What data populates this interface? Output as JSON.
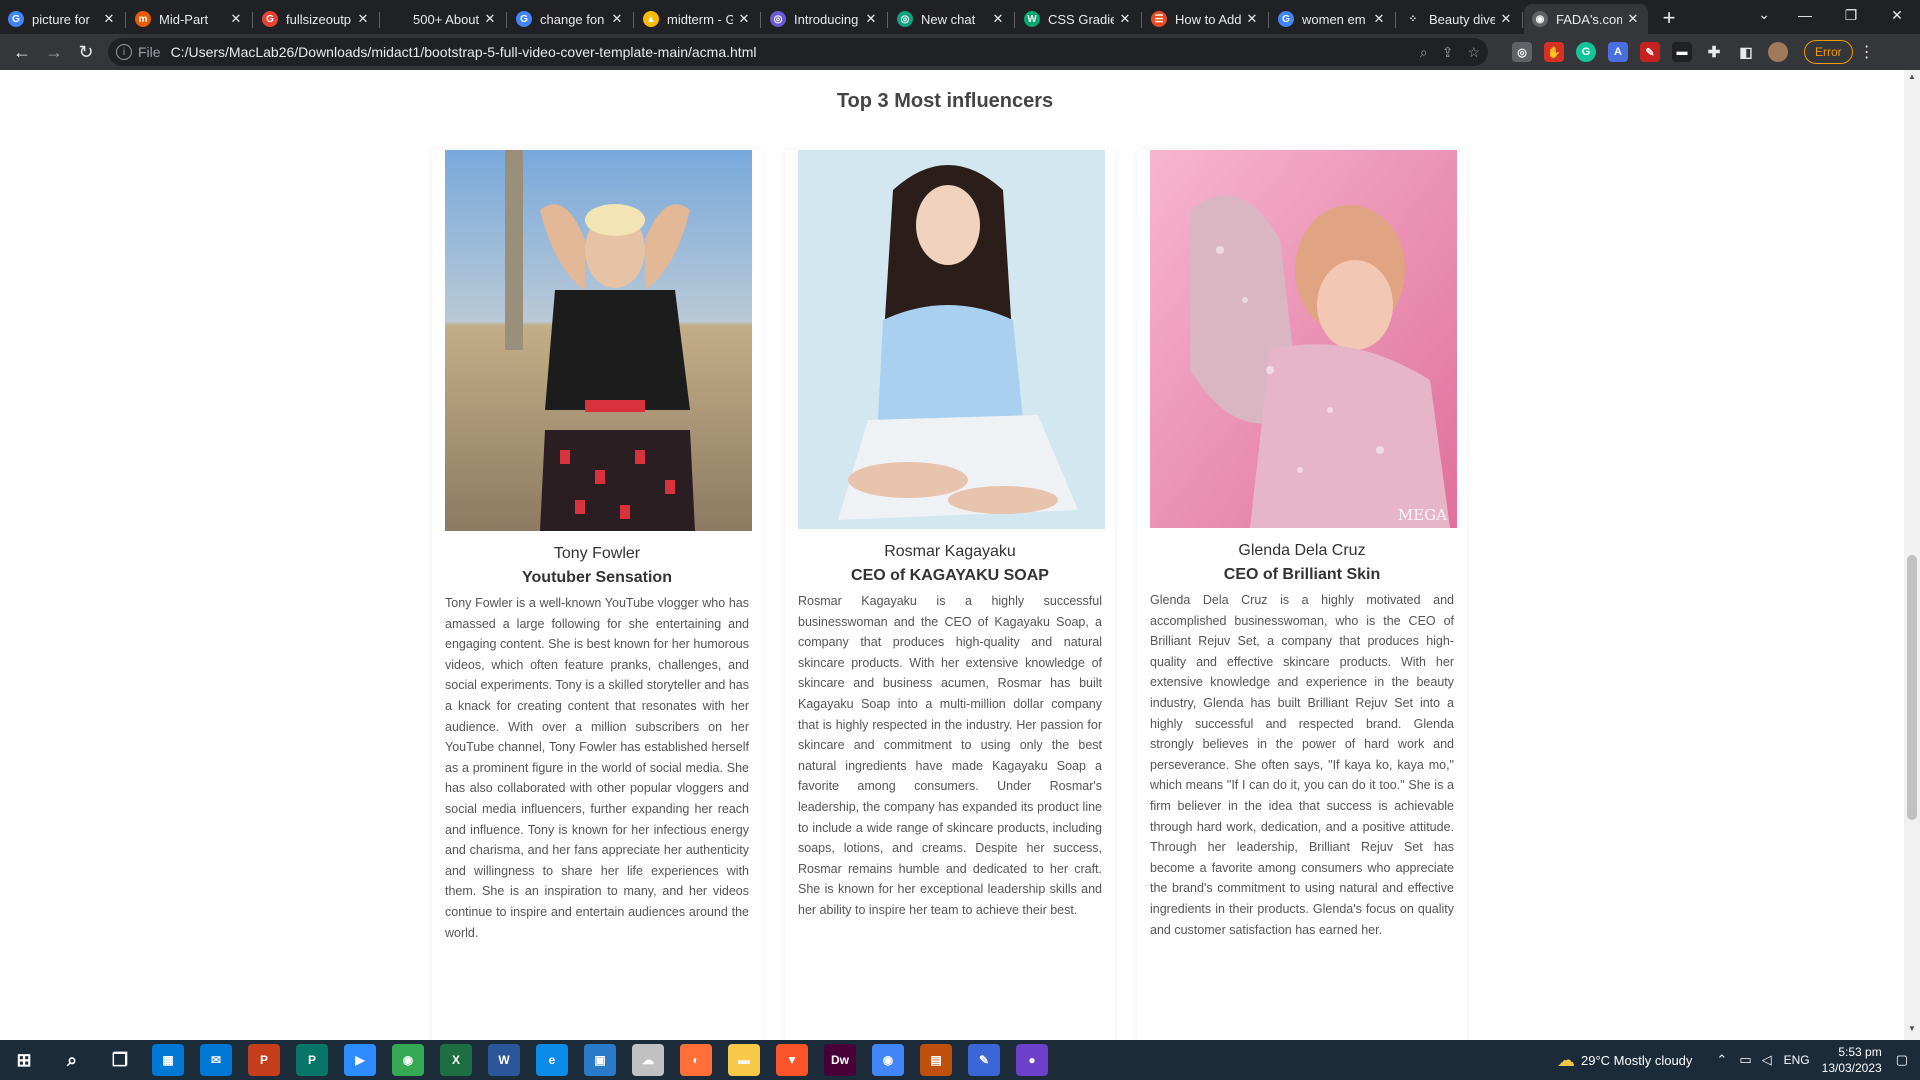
{
  "browser": {
    "tabs": [
      {
        "title": "picture for",
        "favicon": "google-icon",
        "color": "#4285f4",
        "glyph": "G"
      },
      {
        "title": "Mid-Part",
        "favicon": "medium-icon",
        "color": "#e65c00",
        "glyph": "m"
      },
      {
        "title": "fullsizeoutp",
        "favicon": "google-red-icon",
        "color": "#ea4335",
        "glyph": "G"
      },
      {
        "title": "500+ About",
        "favicon": "unsplash-icon",
        "color": "#202124",
        "glyph": ""
      },
      {
        "title": "change fon",
        "favicon": "google-icon",
        "color": "#4285f4",
        "glyph": "G"
      },
      {
        "title": "midterm - G",
        "favicon": "drive-icon",
        "color": "#fbbc04",
        "glyph": "▲"
      },
      {
        "title": "Introducing",
        "favicon": "openai-icon",
        "color": "#6b5bd6",
        "glyph": "◎"
      },
      {
        "title": "New chat",
        "favicon": "chatgpt-icon",
        "color": "#10a37f",
        "glyph": "◎"
      },
      {
        "title": "CSS Gradie",
        "favicon": "w3schools-icon",
        "color": "#04aa6d",
        "glyph": "W"
      },
      {
        "title": "How to Add",
        "favicon": "tutorial-icon",
        "color": "#e44d26",
        "glyph": "☰"
      },
      {
        "title": "women em",
        "favicon": "google-icon",
        "color": "#4285f4",
        "glyph": "G"
      },
      {
        "title": "Beauty dive",
        "favicon": "loading-icon",
        "color": "#202124",
        "glyph": "⁘"
      },
      {
        "title": "FADA's.com",
        "favicon": "globe-icon",
        "color": "#5f6368",
        "glyph": "◉",
        "active": true
      }
    ],
    "new_tab": "+",
    "address": {
      "scheme_label": "File",
      "url": "C:/Users/MacLab26/Downloads/midact1/bootstrap-5-full-video-cover-template-main/acma.html"
    },
    "error_label": "Error"
  },
  "page": {
    "section_title": "Top 3 Most influencers",
    "cards": [
      {
        "name": "Tony Fowler",
        "role": "Youtuber Sensation",
        "bio": "Tony Fowler is a well-known YouTube vlogger who has amassed a large following for she entertaining and engaging content. She is best known for her humorous videos, which often feature pranks, challenges, and social experiments. Tony is a skilled storyteller and has a knack for creating content that resonates with her audience. With over a million subscribers on her YouTube channel, Tony Fowler has established herself as a prominent figure in the world of social media. She has also collaborated with other popular vloggers and social media influencers, further expanding her reach and influence. Tony is known for her infectious energy and charisma, and her fans appreciate her authenticity and willingness to share her life experiences with them. She is an inspiration to many, and her videos continue to inspire and entertain audiences around the world.",
        "photo_colors": [
          "#7aa7d8",
          "#c9b38f",
          "#2a2a2a"
        ]
      },
      {
        "name": "Rosmar Kagayaku",
        "role": "CEO of KAGAYAKU SOAP",
        "bio": "Rosmar Kagayaku is a highly successful businesswoman and the CEO of Kagayaku Soap, a company that produces high-quality and natural skincare products. With her extensive knowledge of skincare and business acumen, Rosmar has built Kagayaku Soap into a multi-million dollar company that is highly respected in the industry. Her passion for skincare and commitment to using only the best natural ingredients have made Kagayaku Soap a favorite among consumers. Under Rosmar's leadership, the company has expanded its product line to include a wide range of skincare products, including soaps, lotions, and creams. Despite her success, Rosmar remains humble and dedicated to her craft. She is known for her exceptional leadership skills and her ability to inspire her team to achieve their best.",
        "photo_colors": [
          "#cfe4ee",
          "#9cc7e8",
          "#2b1e1a"
        ]
      },
      {
        "name": "Glenda Dela Cruz",
        "role": "CEO of Brilliant Skin",
        "bio": "Glenda Dela Cruz is a highly motivated and accomplished businesswoman, who is the CEO of Brilliant Rejuv Set, a company that produces high-quality and effective skincare products. With her extensive knowledge and experience in the beauty industry, Glenda has built Brilliant Rejuv Set into a highly successful and respected brand. Glenda strongly believes in the power of hard work and perseverance. She often says, \"If kaya ko, kaya mo,\" which means \"If I can do it, you can do it too.\" She is a firm believer in the idea that success is achievable through hard work, dedication, and a positive attitude. Through her leadership, Brilliant Rejuv Set has become a favorite among consumers who appreciate the brand's commitment to using natural and effective ingredients in their products. Glenda's focus on quality and customer satisfaction has earned her.",
        "photo_colors": [
          "#f2a6c3",
          "#e27aa3",
          "#d9a37f"
        ],
        "watermark": "MEGA"
      }
    ]
  },
  "taskbar": {
    "weather": "29°C  Mostly cloudy",
    "language": "ENG",
    "time": "5:53 pm",
    "date": "13/03/2023",
    "apps": [
      {
        "name": "windows-start-icon",
        "color": "#1c2b3a",
        "glyph": "⊞"
      },
      {
        "name": "search-icon",
        "color": "#1c2b3a",
        "glyph": "⌕"
      },
      {
        "name": "task-view-icon",
        "color": "#1c2b3a",
        "glyph": "❐"
      },
      {
        "name": "store-icon",
        "color": "#0078d4",
        "glyph": "▦"
      },
      {
        "name": "mail-icon",
        "color": "#0078d4",
        "glyph": "✉"
      },
      {
        "name": "powerpoint-icon",
        "color": "#c43e1c",
        "glyph": "P"
      },
      {
        "name": "publisher-icon",
        "color": "#077568",
        "glyph": "P"
      },
      {
        "name": "zoom-icon",
        "color": "#2d8cff",
        "glyph": "▶"
      },
      {
        "name": "chrome-icon",
        "color": "#34a853",
        "glyph": "◉"
      },
      {
        "name": "excel-icon",
        "color": "#1d6f42",
        "glyph": "X"
      },
      {
        "name": "word-icon",
        "color": "#2b579a",
        "glyph": "W"
      },
      {
        "name": "edge-icon",
        "color": "#0c8ce9",
        "glyph": "e"
      },
      {
        "name": "photos-icon",
        "color": "#2a7ac9",
        "glyph": "▣"
      },
      {
        "name": "cloud-icon",
        "color": "#c1c1c1",
        "glyph": "☁"
      },
      {
        "name": "firefox-icon",
        "color": "#ff7139",
        "glyph": "◐"
      },
      {
        "name": "explorer-icon",
        "color": "#f7c948",
        "glyph": "▬"
      },
      {
        "name": "brave-icon",
        "color": "#fb542b",
        "glyph": "▼"
      },
      {
        "name": "dreamweaver-icon",
        "color": "#470137",
        "glyph": "Dw"
      },
      {
        "name": "chrome-active-icon",
        "color": "#4285f4",
        "glyph": "◉"
      },
      {
        "name": "app-grid-icon",
        "color": "#c05010",
        "glyph": "▤"
      },
      {
        "name": "colorpicker-icon",
        "color": "#3b66d6",
        "glyph": "✎"
      },
      {
        "name": "github-icon",
        "color": "#6e40c9",
        "glyph": "●"
      }
    ]
  },
  "colors": {
    "tab_bg": "#202124",
    "toolbar_bg": "#35363a",
    "taskbar_bg": "#1c2b3a",
    "error_accent": "#f29900"
  }
}
